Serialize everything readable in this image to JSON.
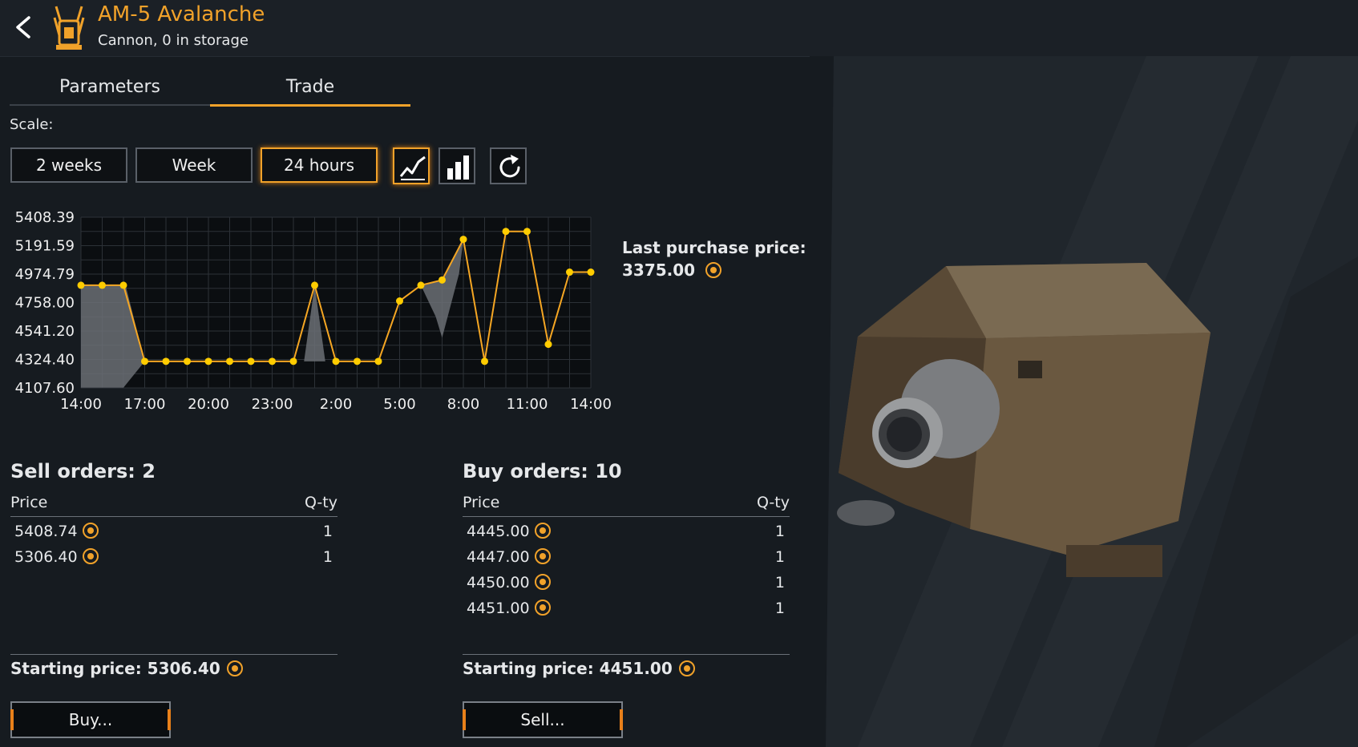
{
  "header": {
    "title": "AM-5 Avalanche",
    "subtitle": "Cannon, 0 in storage",
    "back_icon": "chevron-left-icon",
    "item_icon": "cannon-icon"
  },
  "tabs": [
    {
      "label": "Parameters",
      "active": false
    },
    {
      "label": "Trade",
      "active": true
    }
  ],
  "scale": {
    "label": "Scale:",
    "options": [
      "2 weeks",
      "Week",
      "24 hours"
    ],
    "selected": "24 hours",
    "chart_mode_icons": [
      "line-chart-icon",
      "bar-chart-icon"
    ],
    "refresh_icon": "refresh-icon"
  },
  "last_purchase": {
    "label": "Last purchase price:",
    "value": "3375.00"
  },
  "sell_orders": {
    "title": "Sell orders: 2",
    "col_price": "Price",
    "col_qty": "Q-ty",
    "rows": [
      {
        "price": "5408.74",
        "qty": "1"
      },
      {
        "price": "5306.40",
        "qty": "1"
      }
    ],
    "starting_price_label": "Starting price: 5306.40",
    "button": "Buy..."
  },
  "buy_orders": {
    "title": "Buy orders: 10",
    "col_price": "Price",
    "col_qty": "Q-ty",
    "rows": [
      {
        "price": "4445.00",
        "qty": "1"
      },
      {
        "price": "4447.00",
        "qty": "1"
      },
      {
        "price": "4450.00",
        "qty": "1"
      },
      {
        "price": "4451.00",
        "qty": "1"
      }
    ],
    "starting_price_label": "Starting price: 4451.00",
    "button": "Sell..."
  },
  "colors": {
    "accent": "#f1a22a",
    "line": "#f5a623",
    "point": "#ffcc00",
    "range_fill": "#6b6f74"
  },
  "chart_data": {
    "type": "line",
    "xlim": [
      0,
      24
    ],
    "ylim": [
      4107.6,
      5408.39
    ],
    "xticks": [
      0,
      3,
      6,
      9,
      12,
      15,
      18,
      21,
      24
    ],
    "xtick_labels": [
      "14:00",
      "17:00",
      "20:00",
      "23:00",
      "2:00",
      "5:00",
      "8:00",
      "11:00",
      "14:00"
    ],
    "yticks": [
      4107.6,
      4324.4,
      4541.2,
      4758.0,
      4974.79,
      5191.59,
      5408.39
    ],
    "ytick_labels": [
      "4107.60",
      "4324.40",
      "4541.20",
      "4758.00",
      "4974.79",
      "5191.59",
      "5408.39"
    ],
    "grid": true,
    "series": [
      {
        "x": [
          0,
          1,
          2,
          3,
          4,
          5,
          6,
          7,
          8,
          9,
          10,
          11,
          12,
          13,
          14,
          15,
          16,
          17,
          18,
          19,
          20,
          21,
          22,
          23,
          24
        ],
        "y": [
          4890,
          4890,
          4890,
          4310,
          4310,
          4310,
          4310,
          4310,
          4310,
          4310,
          4310,
          4890,
          4310,
          4310,
          4310,
          4770,
          4890,
          4930,
          5240,
          4310,
          5300,
          5300,
          4440,
          4990,
          4990
        ]
      }
    ],
    "range_bands": [
      {
        "x": [
          0,
          1,
          2,
          2.1,
          3,
          2,
          1,
          0
        ],
        "y": [
          4890,
          4890,
          4890,
          4890,
          4310,
          4110,
          4110,
          4110
        ]
      },
      {
        "x": [
          10.5,
          11,
          11.5
        ],
        "y": [
          4310,
          4890,
          4310
        ]
      },
      {
        "x": [
          16,
          17,
          18,
          17.8,
          17,
          16.7
        ],
        "y": [
          4890,
          4930,
          5240,
          4980,
          4490,
          4650
        ]
      }
    ]
  }
}
